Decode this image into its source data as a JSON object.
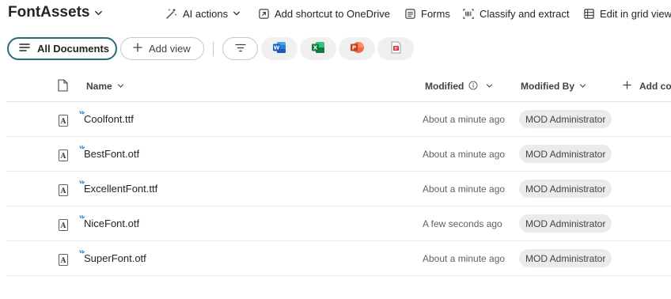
{
  "library": {
    "title": "FontAssets"
  },
  "commands": {
    "ai_actions": "AI actions",
    "add_shortcut": "Add shortcut to OneDrive",
    "forms": "Forms",
    "classify": "Classify and extract",
    "edit_grid": "Edit in grid view"
  },
  "views": {
    "active": "All Documents",
    "add_view": "Add view",
    "type_filters": [
      "word-icon",
      "excel-icon",
      "powerpoint-icon",
      "pdf-icon"
    ]
  },
  "columns": {
    "name": "Name",
    "modified": "Modified",
    "modified_by": "Modified By",
    "add_column": "Add column"
  },
  "rows": [
    {
      "name": "Coolfont.ttf",
      "modified": "About a minute ago",
      "modified_by": "MOD Administrator"
    },
    {
      "name": "BestFont.otf",
      "modified": "About a minute ago",
      "modified_by": "MOD Administrator"
    },
    {
      "name": "ExcellentFont.ttf",
      "modified": "About a minute ago",
      "modified_by": "MOD Administrator"
    },
    {
      "name": "NiceFont.otf",
      "modified": "A few seconds ago",
      "modified_by": "MOD Administrator"
    },
    {
      "name": "SuperFont.otf",
      "modified": "About a minute ago",
      "modified_by": "MOD Administrator"
    }
  ],
  "colors": {
    "accent": "#2a6b78",
    "word": "#185abd",
    "excel": "#107c41",
    "powerpoint": "#c43e1c",
    "pdf": "#d13438",
    "new_file_spark": "#0f6cbd"
  }
}
